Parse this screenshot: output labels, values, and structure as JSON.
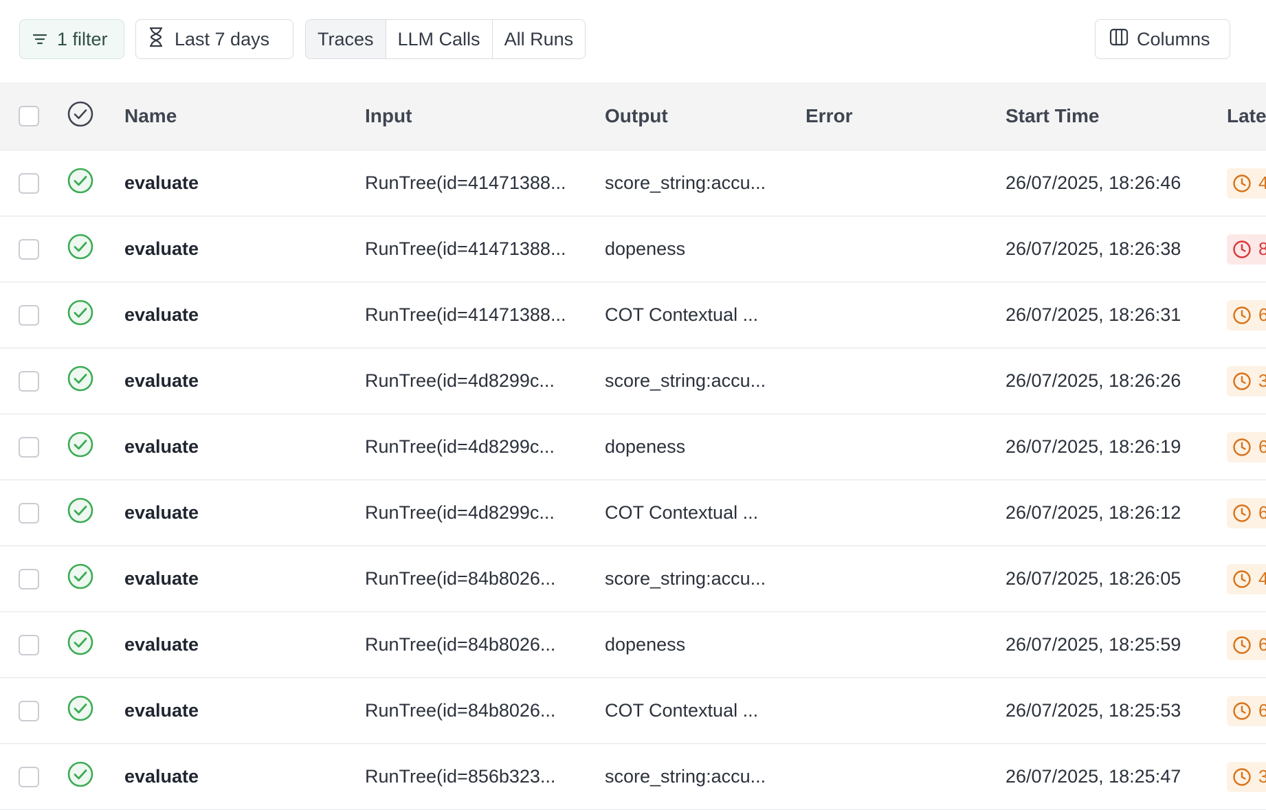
{
  "toolbar": {
    "filter_label": "1 filter",
    "range_label": "Last 7 days",
    "views": [
      {
        "label": "Traces",
        "active": true
      },
      {
        "label": "LLM Calls",
        "active": false
      },
      {
        "label": "All Runs",
        "active": false
      }
    ],
    "columns_label": "Columns"
  },
  "table": {
    "headers": {
      "name": "Name",
      "input": "Input",
      "output": "Output",
      "error": "Error",
      "start_time": "Start Time",
      "latency": "Late"
    },
    "rows": [
      {
        "name": "evaluate",
        "input": "RunTree(id=41471388...",
        "output": "score_string:accu...",
        "error": "",
        "start_time": "26/07/2025, 18:26:46",
        "latency": "4",
        "latency_level": "warn"
      },
      {
        "name": "evaluate",
        "input": "RunTree(id=41471388...",
        "output": "dopeness",
        "error": "",
        "start_time": "26/07/2025, 18:26:38",
        "latency": "8",
        "latency_level": "bad"
      },
      {
        "name": "evaluate",
        "input": "RunTree(id=41471388...",
        "output": "COT Contextual ...",
        "error": "",
        "start_time": "26/07/2025, 18:26:31",
        "latency": "6",
        "latency_level": "warn"
      },
      {
        "name": "evaluate",
        "input": "RunTree(id=4d8299c...",
        "output": "score_string:accu...",
        "error": "",
        "start_time": "26/07/2025, 18:26:26",
        "latency": "3",
        "latency_level": "warn"
      },
      {
        "name": "evaluate",
        "input": "RunTree(id=4d8299c...",
        "output": "dopeness",
        "error": "",
        "start_time": "26/07/2025, 18:26:19",
        "latency": "6",
        "latency_level": "warn"
      },
      {
        "name": "evaluate",
        "input": "RunTree(id=4d8299c...",
        "output": "COT Contextual ...",
        "error": "",
        "start_time": "26/07/2025, 18:26:12",
        "latency": "6",
        "latency_level": "warn"
      },
      {
        "name": "evaluate",
        "input": "RunTree(id=84b8026...",
        "output": "score_string:accu...",
        "error": "",
        "start_time": "26/07/2025, 18:26:05",
        "latency": "4",
        "latency_level": "warn"
      },
      {
        "name": "evaluate",
        "input": "RunTree(id=84b8026...",
        "output": "dopeness",
        "error": "",
        "start_time": "26/07/2025, 18:25:59",
        "latency": "6",
        "latency_level": "warn"
      },
      {
        "name": "evaluate",
        "input": "RunTree(id=84b8026...",
        "output": "COT Contextual ...",
        "error": "",
        "start_time": "26/07/2025, 18:25:53",
        "latency": "6",
        "latency_level": "warn"
      },
      {
        "name": "evaluate",
        "input": "RunTree(id=856b323...",
        "output": "score_string:accu...",
        "error": "",
        "start_time": "26/07/2025, 18:25:47",
        "latency": "3",
        "latency_level": "warn"
      }
    ]
  },
  "colors": {
    "success": "#3bab55",
    "latency_warn": "#d8731a",
    "latency_bad": "#d9383a"
  },
  "icons": {
    "filter": "filter-lines-icon",
    "range": "hourglass-icon",
    "columns": "columns-icon",
    "status_header": "check-circle-icon",
    "status_row": "success-check-circle-icon",
    "latency": "clock-icon"
  }
}
